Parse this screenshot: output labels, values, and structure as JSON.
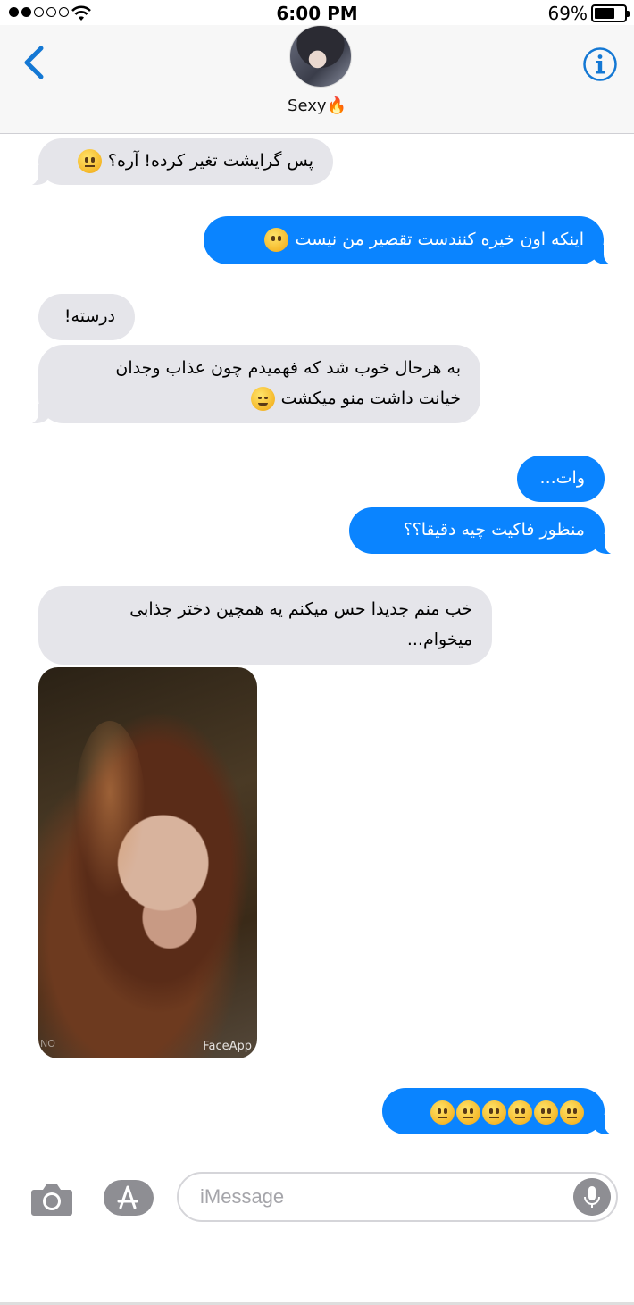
{
  "status_bar": {
    "time": "6:00 PM",
    "battery_percent": "69%",
    "battery_level": 0.69,
    "signal_bars_filled": 2,
    "signal_bars_total": 5,
    "icons": [
      "signal-dots-icon",
      "wifi-icon",
      "battery-icon"
    ]
  },
  "header": {
    "contact_name": "Sexy🔥",
    "icons": [
      "back-chevron-icon",
      "info-icon"
    ]
  },
  "messages": [
    {
      "direction": "incoming",
      "text": "پس گرایشت تغیر کرده! آره؟",
      "emoji": [
        "neutral-face"
      ]
    },
    {
      "direction": "outgoing",
      "text": "اینکه اون خیره کنندست تقصیر من نیست",
      "emoji": [
        "no-mouth-face"
      ]
    },
    {
      "direction": "incoming",
      "text": "درسته!"
    },
    {
      "direction": "incoming",
      "line1": "به هرحال خوب شد که فهمیدم چون عذاب وجدان",
      "line2": "خیانت داشت منو میکشت",
      "emoji": [
        "relieved-face"
      ]
    },
    {
      "direction": "outgoing",
      "text": "وات..."
    },
    {
      "direction": "outgoing",
      "text": "منظور فاکیت چیه دقیقا؟؟"
    },
    {
      "direction": "incoming",
      "line1": "خب منم جدیدا حس میکنم یه همچین دختر جذابی",
      "line2": "میخوام..."
    },
    {
      "direction": "incoming",
      "type": "image",
      "watermark": "FaceApp"
    },
    {
      "direction": "outgoing",
      "emoji": [
        "neutral-face",
        "neutral-face",
        "neutral-face",
        "neutral-face",
        "neutral-face",
        "neutral-face"
      ]
    }
  ],
  "input_bar": {
    "placeholder": "iMessage",
    "icons": [
      "camera-icon",
      "app-store-icon",
      "microphone-icon"
    ]
  },
  "colors": {
    "outgoing_bubble": "#0a84ff",
    "incoming_bubble": "#e5e5ea",
    "accent": "#1478d4"
  }
}
